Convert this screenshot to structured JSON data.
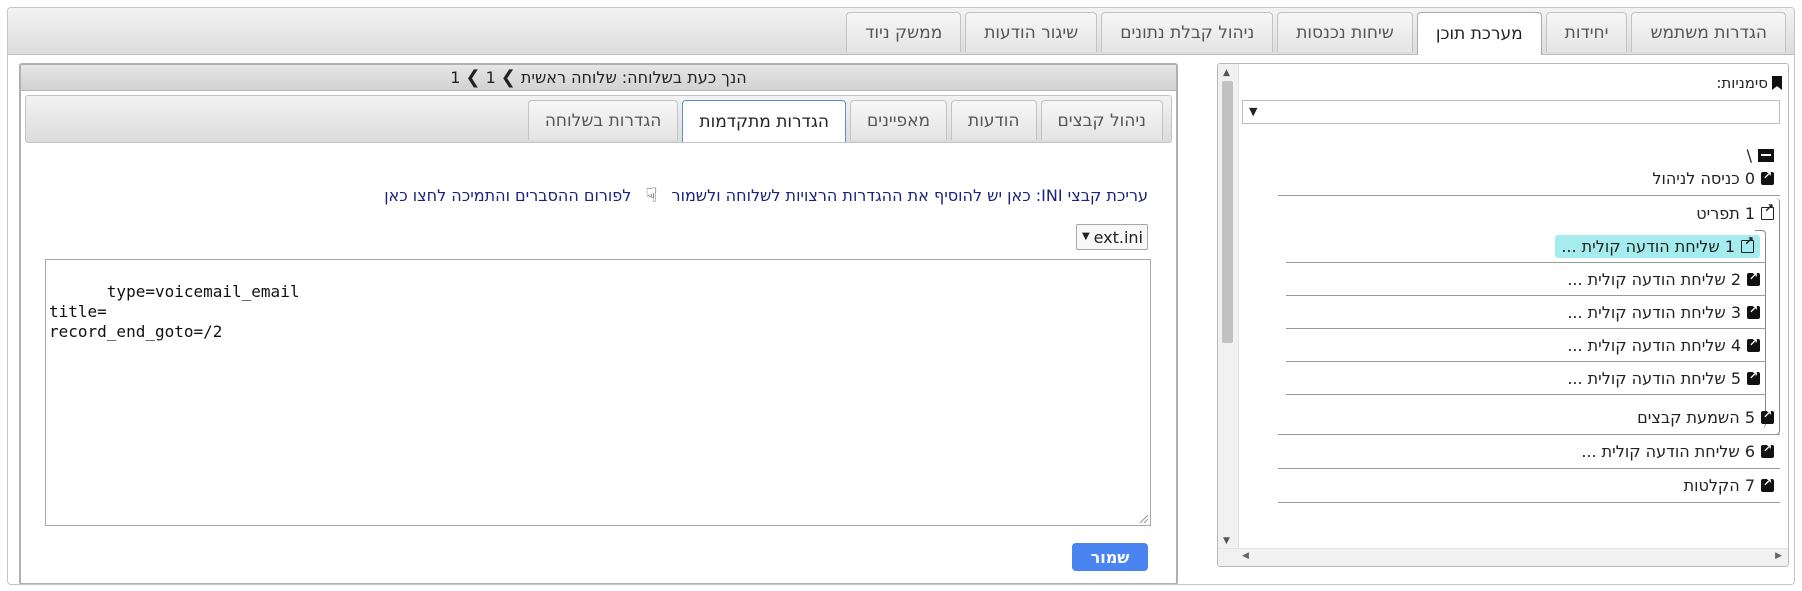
{
  "top_tabs": [
    {
      "label": "הגדרות משתמש"
    },
    {
      "label": "יחידות"
    },
    {
      "label": "מערכת תוכן"
    },
    {
      "label": "שיחות נכנסות"
    },
    {
      "label": "ניהול קבלת נתונים"
    },
    {
      "label": "שיגור הודעות"
    },
    {
      "label": "ממשק ניוד"
    }
  ],
  "top_tabs_active_index": 2,
  "tree": {
    "bookmarks_label": "סימניות:",
    "bookmarks_value": "",
    "root_label": "\\",
    "items": [
      {
        "label": "0 כניסה לניהול"
      },
      {
        "label": "1 תפריט"
      },
      {
        "label": "1 שליחת הודעה קולית ..."
      },
      {
        "label": "2 שליחת הודעה קולית ..."
      },
      {
        "label": "3 שליחת הודעה קולית ..."
      },
      {
        "label": "4 שליחת הודעה קולית ..."
      },
      {
        "label": "5 שליחת הודעה קולית ..."
      },
      {
        "label": "5 השמעת קבצים"
      },
      {
        "label": "6 שליחת הודעה קולית ..."
      },
      {
        "label": "7 הקלטות"
      }
    ]
  },
  "location": {
    "prefix": "הנך כעת בשלוחה:",
    "root": "שלוחה ראשית",
    "sep": "❯",
    "crumbs": [
      "1",
      "1"
    ]
  },
  "sub_tabs": [
    {
      "label": "ניהול קבצים"
    },
    {
      "label": "הודעות"
    },
    {
      "label": "מאפיינים"
    },
    {
      "label": "הגדרות מתקדמות"
    },
    {
      "label": "הגדרות בשלוחה"
    }
  ],
  "sub_tabs_active_index": 3,
  "ini": {
    "intro": "עריכת קבצי INI: כאן יש להוסיף את ההגדרות הרצויות לשלוחה ולשמור",
    "forum_link": "לפורום ההסברים והתמיכה לחצו כאן",
    "file_selected": "ext.ini",
    "content": "type=voicemail_email\ntitle=\nrecord_end_goto=/2",
    "save_label": "שמור"
  },
  "colors": {
    "accent": "#4a84f0",
    "highlight": "#a4ecee",
    "link": "#1a237e"
  },
  "icons": {
    "bookmark": "bookmark-icon",
    "archive": "archive-box-icon",
    "link_item": "external-link-square-icon",
    "open_item": "external-link-outline-icon",
    "hand": "pointing-hand-icon"
  }
}
